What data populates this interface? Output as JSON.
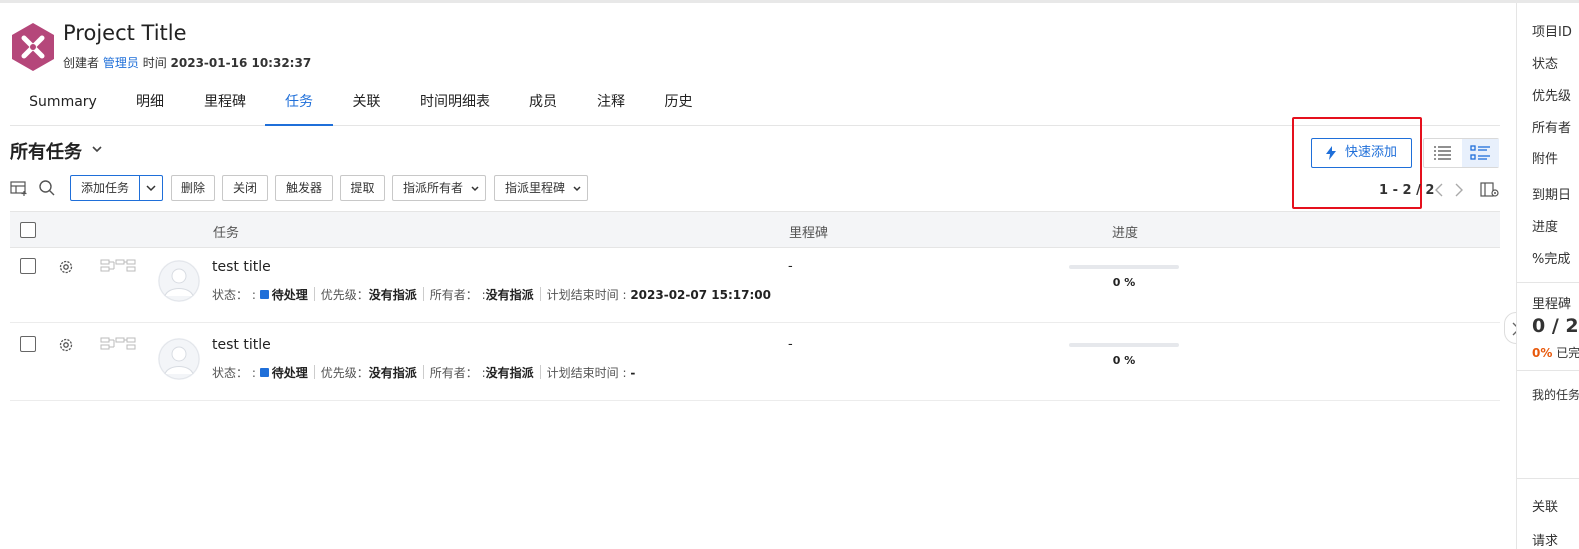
{
  "project": {
    "title": "Project Title",
    "creator_label": "创建者",
    "creator": "管理员",
    "time_label": "时间",
    "time": "2023-01-16 10:32:37"
  },
  "tabs": [
    {
      "label": "Summary",
      "active": false
    },
    {
      "label": "明细",
      "active": false
    },
    {
      "label": "里程碑",
      "active": false
    },
    {
      "label": "任务",
      "active": true
    },
    {
      "label": "关联",
      "active": false
    },
    {
      "label": "时间明细表",
      "active": false
    },
    {
      "label": "成员",
      "active": false
    },
    {
      "label": "注释",
      "active": false
    },
    {
      "label": "历史",
      "active": false
    }
  ],
  "section": {
    "title": "所有任务"
  },
  "toolbar": {
    "add_task": "添加任务",
    "delete": "删除",
    "close": "关闭",
    "trigger": "触发器",
    "fetch": "提取",
    "assign_owner": "指派所有者",
    "assign_milestone": "指派里程碑"
  },
  "quick_add": {
    "label": "快速添加"
  },
  "pager": {
    "text": "1 - 2 / 2"
  },
  "table": {
    "headers": {
      "task": "任务",
      "milestone": "里程碑",
      "progress": "进度"
    },
    "status_label": "状态：",
    "priority_label": "优先级：",
    "owner_label": "所有者：",
    "due_label": "计划结束时间 :",
    "rows": [
      {
        "title": "test title",
        "status": "待处理",
        "priority": "没有指派",
        "owner": "没有指派",
        "due": "2023-02-07 15:17:00",
        "milestone": "-",
        "progress": 0,
        "progress_text": "0 %"
      },
      {
        "title": "test title",
        "status": "待处理",
        "priority": "没有指派",
        "owner": "没有指派",
        "due": "-",
        "milestone": "-",
        "progress": 0,
        "progress_text": "0 %"
      }
    ]
  },
  "side_panel": {
    "labels": [
      "项目ID",
      "状态",
      "优先级",
      "所有者",
      "附件",
      "到期日",
      "进度",
      "%完成"
    ],
    "milestone_label": "里程碑",
    "milestone_count": "0 / 2",
    "milestone_pct": "0%",
    "milestone_done": "已完成",
    "my_tasks": "我的任务",
    "related": "关联",
    "requests": "请求"
  },
  "colors": {
    "accent": "#1f6fd9",
    "highlight_box": "#e5101d",
    "logo": "#b5477a"
  }
}
